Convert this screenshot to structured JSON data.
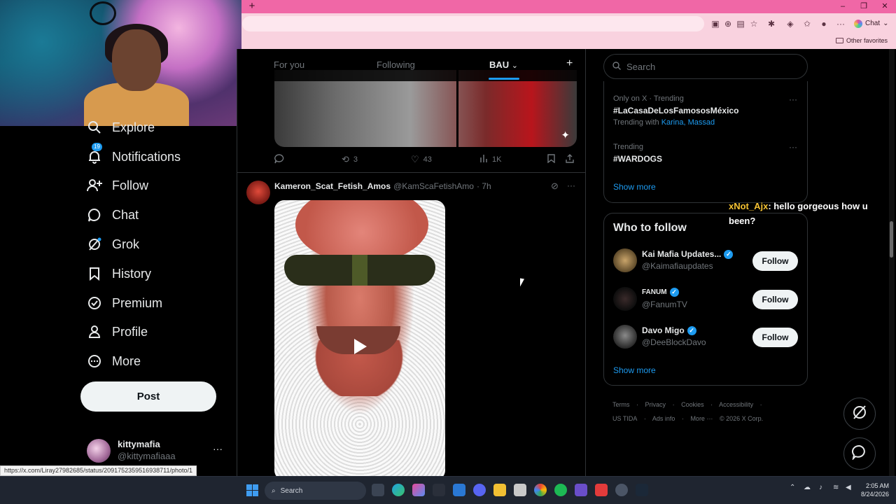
{
  "browser": {
    "new_tab_glyph": "+",
    "chat_label": "Chat",
    "favorites_label": "Other favorites"
  },
  "sidebar": {
    "items": [
      {
        "label": "Explore",
        "icon": "search-icon"
      },
      {
        "label": "Notifications",
        "icon": "bell-icon",
        "badge": "19"
      },
      {
        "label": "Follow",
        "icon": "add-user-icon"
      },
      {
        "label": "Chat",
        "icon": "chat-bubble-icon"
      },
      {
        "label": "Grok",
        "icon": "grok-icon"
      },
      {
        "label": "History",
        "icon": "bookmark-icon"
      },
      {
        "label": "Premium",
        "icon": "verified-badge-icon"
      },
      {
        "label": "Profile",
        "icon": "person-icon"
      },
      {
        "label": "More",
        "icon": "more-circle-icon"
      }
    ],
    "post_label": "Post",
    "account": {
      "name": "kittymafia",
      "handle": "@kittymafiaaa",
      "more": "···"
    }
  },
  "status_url": "https://x.com/Liray27982685/status/2091752359516938711/photo/1",
  "feed": {
    "tabs": [
      {
        "label": "For you",
        "active": false
      },
      {
        "label": "Following",
        "active": false
      },
      {
        "label": "BAU",
        "active": true
      }
    ],
    "add_tab": "+",
    "tweet1_actions": {
      "reposts": "3",
      "likes": "43",
      "views": "1K"
    },
    "tweet2": {
      "name": "Kameron_Scat_Fetish_Amos",
      "handle": "@KamScaFetishAmo",
      "time": "· 7h"
    }
  },
  "right": {
    "search_placeholder": "Search",
    "trends": [
      {
        "meta": "Only on X · Trending",
        "tag": "#LaCasaDeLosFamososMéxico",
        "with_prefix": "Trending with",
        "with_links": "Karina, Massad"
      },
      {
        "meta": "Trending",
        "tag": "#WARDOGS"
      }
    ],
    "show_more": "Show more",
    "who_to_follow": {
      "title": "Who to follow",
      "accounts": [
        {
          "name": "Kai Mafia Updates...",
          "handle": "@Kaimafiaupdates",
          "button": "Follow"
        },
        {
          "name": "FANUM",
          "handle": "@FanumTV",
          "button": "Follow"
        },
        {
          "name": "Davo Migo",
          "handle": "@DeeBlockDavo",
          "button": "Follow"
        }
      ],
      "show_more": "Show more"
    },
    "footer": {
      "links": [
        "Terms",
        "Privacy",
        "Cookies",
        "Accessibility",
        "US TIDA",
        "Ads info",
        "More ···"
      ],
      "copyright": "© 2026 X Corp."
    }
  },
  "stream_chat": {
    "user": "xNot_Ajx",
    "message": ": hello gorgeous how u been?"
  },
  "taskbar": {
    "search_label": "Search",
    "time": "2:05 AM",
    "date": "8/24/2026"
  },
  "colors": {
    "accent": "#1d9bf0",
    "tabbar": "#f067a6",
    "chat_user": "#f5c233"
  }
}
